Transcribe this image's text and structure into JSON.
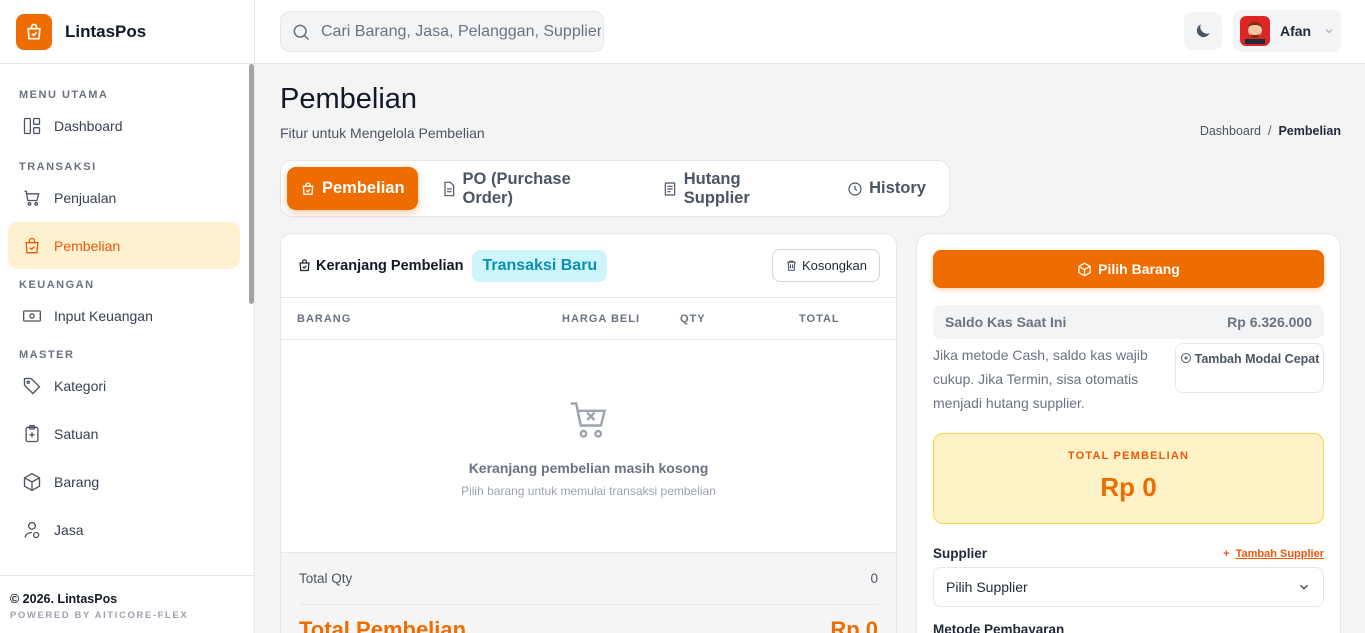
{
  "app": {
    "name": "LintasPos"
  },
  "sidebar": {
    "sections": {
      "menu_utama": "MENU UTAMA",
      "transaksi": "TRANSAKSI",
      "keuangan": "KEUANGAN",
      "master": "MASTER"
    },
    "items": [
      {
        "label": "Dashboard",
        "icon": "dashboard-icon"
      },
      {
        "label": "Penjualan",
        "icon": "cart-icon"
      },
      {
        "label": "Pembelian",
        "icon": "shopping-bag-icon",
        "active": true
      },
      {
        "label": "Input Keuangan",
        "icon": "cash-icon"
      },
      {
        "label": "Kategori",
        "icon": "tag-icon"
      },
      {
        "label": "Satuan",
        "icon": "clipboard-icon"
      },
      {
        "label": "Barang",
        "icon": "box-icon"
      },
      {
        "label": "Jasa",
        "icon": "user-service-icon"
      }
    ],
    "footer": {
      "copyright": "© 2026. LintasPos",
      "powered": "POWERED BY AITICORE-FLEX"
    }
  },
  "header": {
    "search_placeholder": "Cari Barang, Jasa, Pelanggan, Supplier...",
    "user_name": "Afan"
  },
  "page": {
    "title": "Pembelian",
    "subtitle": "Fitur untuk Mengelola Pembelian",
    "breadcrumb": {
      "parent": "Dashboard",
      "separator": "/",
      "current": "Pembelian"
    }
  },
  "tabs": [
    {
      "label": "Pembelian",
      "icon": "shopping-bag-icon",
      "active": true
    },
    {
      "label": "PO (Purchase Order)",
      "icon": "document-icon"
    },
    {
      "label": "Hutang Supplier",
      "icon": "receipt-icon"
    },
    {
      "label": "History",
      "icon": "clock-icon"
    }
  ],
  "cart": {
    "title": "Keranjang Pembelian",
    "badge": "Transaksi Baru",
    "clear_label": "Kosongkan",
    "columns": [
      "BARANG",
      "HARGA BELI",
      "QTY",
      "TOTAL"
    ],
    "empty_title": "Keranjang pembelian masih kosong",
    "empty_sub": "Pilih barang untuk memulai transaksi pembelian",
    "total_qty_label": "Total Qty",
    "total_qty_value": "0",
    "total_label": "Total Pembelian",
    "total_value": "Rp 0"
  },
  "panel": {
    "pick_label": "Pilih Barang",
    "saldo_label": "Saldo Kas Saat Ini",
    "saldo_value": "Rp 6.326.000",
    "info": "Jika metode Cash, saldo kas wajib cukup. Jika Termin, sisa otomatis menjadi hutang supplier.",
    "modal_label": "Tambah Modal Cepat",
    "total_label": "TOTAL PEMBELIAN",
    "total_value": "Rp 0",
    "supplier_label": "Supplier",
    "supplier_add": "Tambah Supplier",
    "supplier_select": "Pilih Supplier",
    "metode_label": "Metode Pembayaran"
  },
  "colors": {
    "accent": "#ef6c00",
    "active_bg": "#fdf1cf",
    "badge_bg": "#cdf5fb",
    "badge_text": "#0891b2"
  }
}
